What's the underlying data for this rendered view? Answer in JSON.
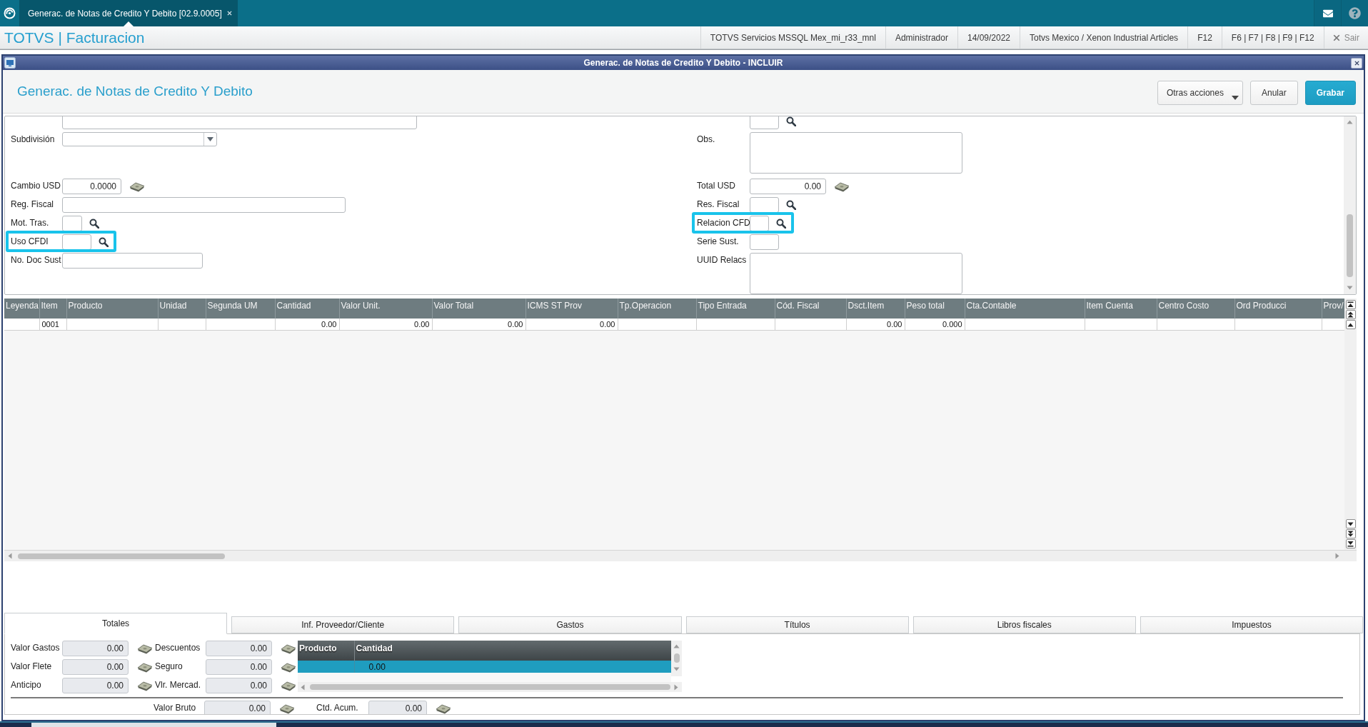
{
  "top_bar": {
    "tab": {
      "label": "Generac. de Notas de Credito Y Debito [02.9.0005]",
      "selected": true
    }
  },
  "app_bar": {
    "title": "TOTVS | Facturacion",
    "items": [
      "TOTVS Servicios MSSQL Mex_mi_r33_mnl",
      "Administrador",
      "14/09/2022",
      "Totvs Mexico / Xenon Industrial Articles",
      "F12",
      "F6 | F7 | F8 | F9 | F12"
    ],
    "exit": "Sair"
  },
  "dialog": {
    "title": "Generac. de Notas de Credito Y Debito - INCLUIR",
    "heading": "Generac. de Notas de Credito Y Debito",
    "buttons": [
      {
        "label": "Otras acciones",
        "kind": "menu"
      },
      {
        "label": "Anular",
        "kind": "secondary"
      },
      {
        "label": "Grabar",
        "kind": "primary"
      }
    ]
  },
  "form": {
    "rows": [
      {
        "left": {
          "kind": "text",
          "highlighted": false
        },
        "right": {
          "kind": "lookup",
          "highlighted": false
        }
      },
      {
        "left": {
          "label": "Subdivisión",
          "kind": "combo",
          "highlighted": false
        },
        "right": {
          "label": "Obs.",
          "kind": "memo",
          "highlighted": false
        }
      },
      {
        "left": {
          "label": "Cambio USD",
          "kind": "number",
          "value": "0.0000",
          "highlighted": false
        },
        "right": {
          "label": "Total USD",
          "kind": "number",
          "value": "0.00",
          "highlighted": false
        }
      },
      {
        "left": {
          "label": "Reg. Fiscal",
          "kind": "text",
          "highlighted": false
        },
        "right": {
          "label": "Res. Fiscal",
          "kind": "lookup",
          "highlighted": false
        }
      },
      {
        "left": {
          "label": "Mot. Tras.",
          "kind": "lookup",
          "highlighted": false
        },
        "right": {
          "label": "Relacion CFD",
          "kind": "lookup",
          "highlighted": true
        }
      },
      {
        "left": {
          "label": "Uso CFDI",
          "kind": "lookup",
          "highlighted": true
        },
        "right": {
          "label": "Serie Sust.",
          "kind": "text",
          "highlighted": false
        }
      },
      {
        "left": {
          "label": "No. Doc Sust",
          "kind": "text",
          "highlighted": false
        },
        "right": {
          "label": "UUID Relacs",
          "kind": "memo",
          "highlighted": false
        }
      }
    ]
  },
  "grid": {
    "columns": [
      {
        "label": "Leyenda",
        "kind": "text"
      },
      {
        "label": "Item",
        "kind": "text"
      },
      {
        "label": "Producto",
        "kind": "text"
      },
      {
        "label": "Unidad",
        "kind": "text"
      },
      {
        "label": "Segunda UM",
        "kind": "text"
      },
      {
        "label": "Cantidad",
        "kind": "number"
      },
      {
        "label": "Valor Unit.",
        "kind": "number"
      },
      {
        "label": "Valor Total",
        "kind": "number"
      },
      {
        "label": "ICMS ST Prov",
        "kind": "number"
      },
      {
        "label": "Tp.Operacion",
        "kind": "text"
      },
      {
        "label": "Tipo Entrada",
        "kind": "text"
      },
      {
        "label": "Cód. Fiscal",
        "kind": "text"
      },
      {
        "label": "Dsct.Item",
        "kind": "number"
      },
      {
        "label": "Peso total",
        "kind": "number"
      },
      {
        "label": "Cta.Contable",
        "kind": "text"
      },
      {
        "label": "Item Cuenta",
        "kind": "text"
      },
      {
        "label": "Centro Costo",
        "kind": "text"
      },
      {
        "label": "Ord Producci",
        "kind": "text"
      },
      {
        "label": "Prov/",
        "kind": "text"
      }
    ],
    "rows": [
      {
        "cells": [
          null,
          "0001",
          null,
          null,
          null,
          "0.00",
          "0.00",
          "0.00",
          "0.00",
          null,
          null,
          null,
          "0.00",
          "0.000",
          null,
          null,
          null,
          null,
          null
        ]
      }
    ]
  },
  "tabs": [
    {
      "label": "Totales",
      "selected": true
    },
    {
      "label": "Inf. Proveedor/Cliente",
      "selected": false
    },
    {
      "label": "Gastos",
      "selected": false
    },
    {
      "label": "Títulos",
      "selected": false
    },
    {
      "label": "Libros fiscales",
      "selected": false
    },
    {
      "label": "Impuestos",
      "selected": false
    }
  ],
  "totals": {
    "column_1": [
      {
        "label": "Valor Gastos",
        "value": "0.00"
      },
      {
        "label": "Valor Flete",
        "value": "0.00"
      },
      {
        "label": "Anticipo",
        "value": "0.00"
      }
    ],
    "column_2": [
      {
        "label": "Descuentos",
        "value": "0.00"
      },
      {
        "label": "Seguro",
        "value": "0.00"
      },
      {
        "label": "Vlr. Mercad.",
        "value": "0.00"
      }
    ],
    "items_grid": {
      "columns": [
        "Producto",
        "Cantidad"
      ],
      "rows": [
        {
          "cells": [
            null,
            "0.00"
          ],
          "selected": true
        }
      ]
    },
    "footer": [
      {
        "label": "Valor Bruto",
        "value": "0.00"
      },
      {
        "label": "Ctd. Acum.",
        "value": "0.00"
      }
    ]
  }
}
